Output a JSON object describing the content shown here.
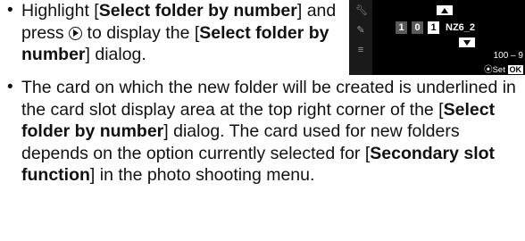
{
  "bullet": "•",
  "item1": {
    "t1": "Highlight [",
    "b1": "Select folder by number",
    "t2": "] and press ",
    "t3": " to display the [",
    "b2": "Select folder by number",
    "t4": "] dialog."
  },
  "item2": {
    "t1": "The card on which the new folder will be created is underlined in the card slot display area at the top right corner of the [",
    "b1": "Select folder by number",
    "t2": "] dialog. The card used for new folders depends on the option currently selected for [",
    "b2": "Secondary slot function",
    "t3": "] in the photo shooting menu."
  },
  "screen": {
    "digits": [
      "1",
      "0",
      "1"
    ],
    "folder_suffix": "NZ6_2",
    "range": "100 – 9",
    "set_label": "Set",
    "ok_label": "OK"
  },
  "icons": {
    "multi_selector": "multi-selector-right-icon",
    "side": [
      "wrench-icon",
      "pencil-icon",
      "menu-icon"
    ]
  }
}
